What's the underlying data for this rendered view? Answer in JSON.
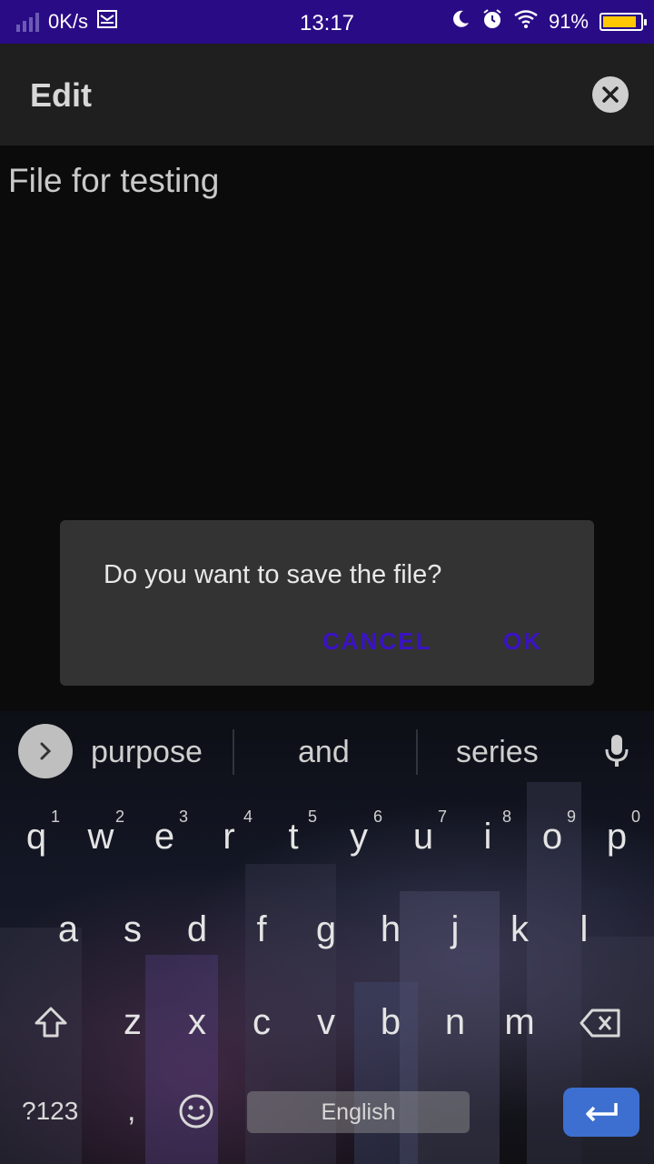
{
  "status_bar": {
    "speed": "0K/s",
    "time": "13:17",
    "battery_percent": "91%",
    "battery_level": 0.91,
    "icons": [
      "signal-icon",
      "mail-icon",
      "moon-icon",
      "alarm-icon",
      "wifi-icon",
      "battery-icon"
    ]
  },
  "app_bar": {
    "title": "Edit",
    "close_icon": "close-icon"
  },
  "editor": {
    "content": "File for testing"
  },
  "dialog": {
    "message": "Do you want to save the file?",
    "cancel_label": "CANCEL",
    "ok_label": "OK",
    "button_color": "#3a12c4"
  },
  "keyboard": {
    "suggestions": [
      "purpose",
      "and",
      "series"
    ],
    "row1": [
      "q",
      "w",
      "e",
      "r",
      "t",
      "y",
      "u",
      "i",
      "o",
      "p"
    ],
    "row1_hints": [
      "1",
      "2",
      "3",
      "4",
      "5",
      "6",
      "7",
      "8",
      "9",
      "0"
    ],
    "row2": [
      "a",
      "s",
      "d",
      "f",
      "g",
      "h",
      "j",
      "k",
      "l"
    ],
    "row3": [
      "z",
      "x",
      "c",
      "v",
      "b",
      "n",
      "m"
    ],
    "symbols_label": "?123",
    "comma_label": ",",
    "space_label": "English",
    "enter_color": "#3c6fcf"
  }
}
